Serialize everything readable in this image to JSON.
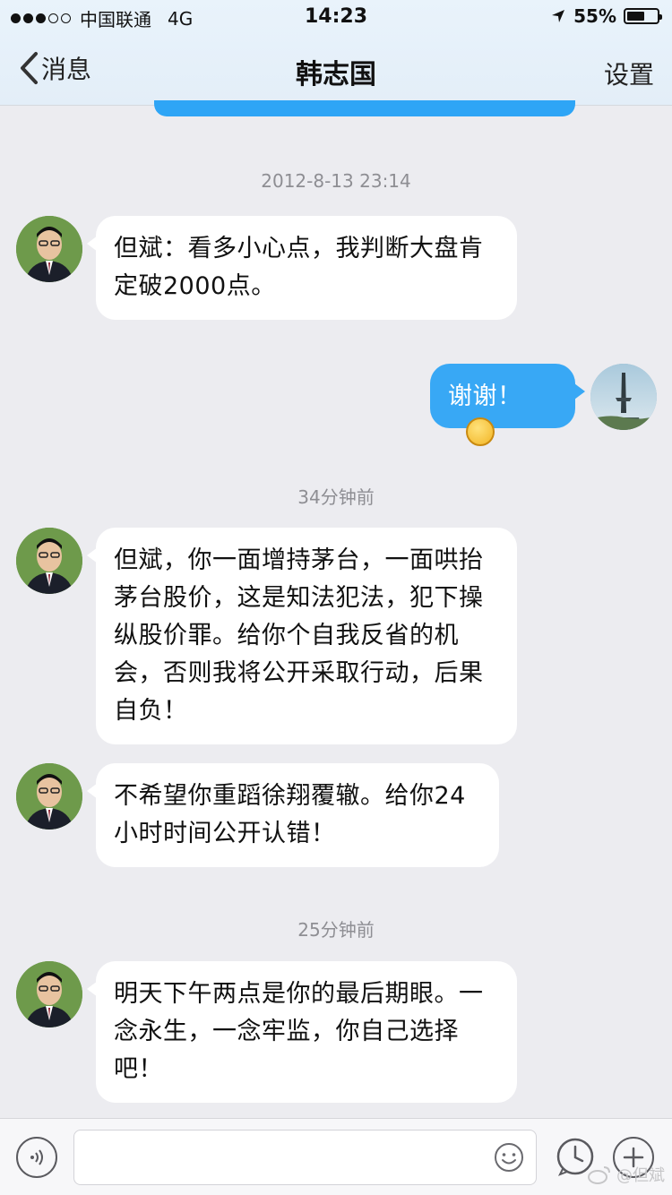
{
  "status_bar": {
    "carrier": "中国联通",
    "network": "4G",
    "time": "14:23",
    "battery": "55%"
  },
  "nav": {
    "back_label": "消息",
    "title": "韩志国",
    "settings_label": "设置"
  },
  "messages": [
    {
      "type": "timestamp",
      "text": "2012-8-13 23:14"
    },
    {
      "type": "incoming",
      "text": "但斌：看多小心点，我判断大盘肯定破2000点。"
    },
    {
      "type": "outgoing",
      "text": "谢谢！",
      "emoji": "laughing-emoji"
    },
    {
      "type": "timestamp",
      "text": "34分钟前"
    },
    {
      "type": "incoming",
      "text": "但斌，你一面增持茅台，一面哄抬茅台股价，这是知法犯法，犯下操纵股价罪。给你个自我反省的机会，否则我将公开采取行动，后果自负！"
    },
    {
      "type": "incoming",
      "text": "不希望你重蹈徐翔覆辙。给你24小时时间公开认错！"
    },
    {
      "type": "timestamp",
      "text": "25分钟前"
    },
    {
      "type": "incoming",
      "text": "明天下午两点是你的最后期眼。一念永生，一念牢监，你自己选择吧！"
    }
  ],
  "input_bar": {
    "voice_icon": "voice-icon",
    "emoji_icon": "smiley-icon",
    "clock_icon": "clock-icon",
    "plus_icon": "plus-icon",
    "placeholder": ""
  },
  "watermark": "@但斌",
  "colors": {
    "outgoing_bubble": "#38a8f5",
    "incoming_bubble": "#ffffff",
    "background": "#ececf0"
  }
}
